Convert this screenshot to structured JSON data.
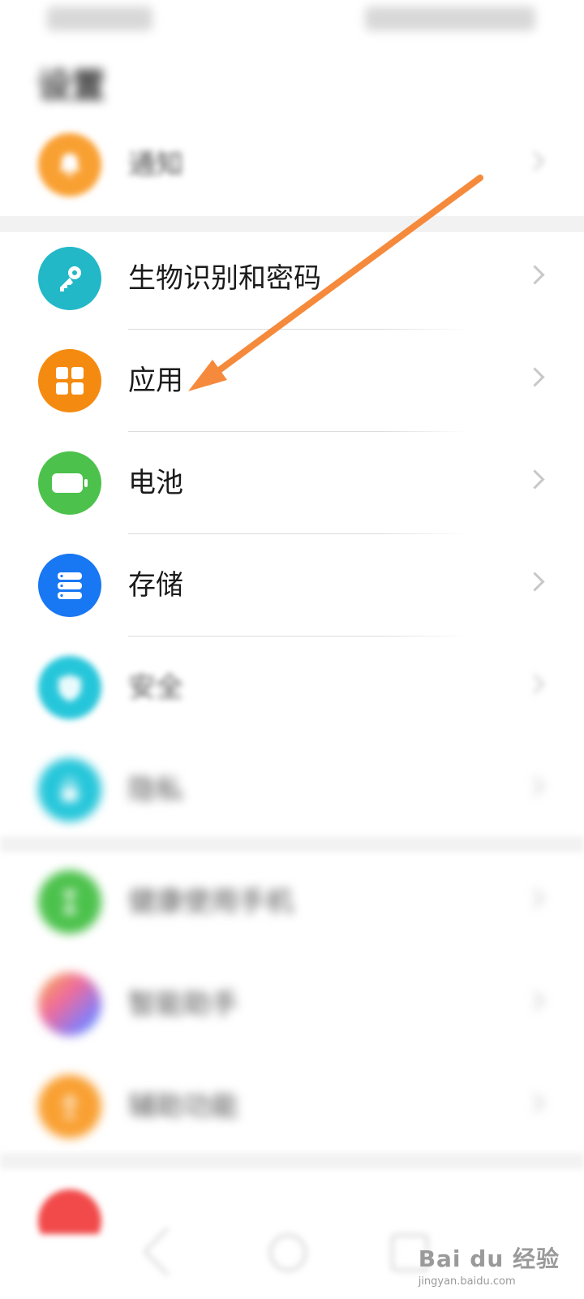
{
  "settings": {
    "title": "设置",
    "items": [
      {
        "label": "通知",
        "icon": "bell-icon",
        "color": "#F9A032"
      },
      {
        "label": "生物识别和密码",
        "icon": "key-icon",
        "color": "#22B8C8"
      },
      {
        "label": "应用",
        "icon": "apps-grid-icon",
        "color": "#F58A10"
      },
      {
        "label": "电池",
        "icon": "battery-icon",
        "color": "#4CC24C"
      },
      {
        "label": "存储",
        "icon": "storage-icon",
        "color": "#1877F2"
      },
      {
        "label": "安全",
        "icon": "shield-icon",
        "color": "#26C6DA"
      },
      {
        "label": "隐私",
        "icon": "privacy-icon",
        "color": "#26C6DA"
      },
      {
        "label": "健康使用手机",
        "icon": "hourglass-icon",
        "color": "#4CC24C"
      },
      {
        "label": "智能助手",
        "icon": "assistant-icon",
        "color": "#B17AF0"
      },
      {
        "label": "辅助功能",
        "icon": "accessibility-icon",
        "color": "#F9A032"
      }
    ]
  },
  "annotation": {
    "color": "#F58A3C"
  },
  "watermark": {
    "brand": "Bai du 经验",
    "url": "jingyan.baidu.com"
  }
}
